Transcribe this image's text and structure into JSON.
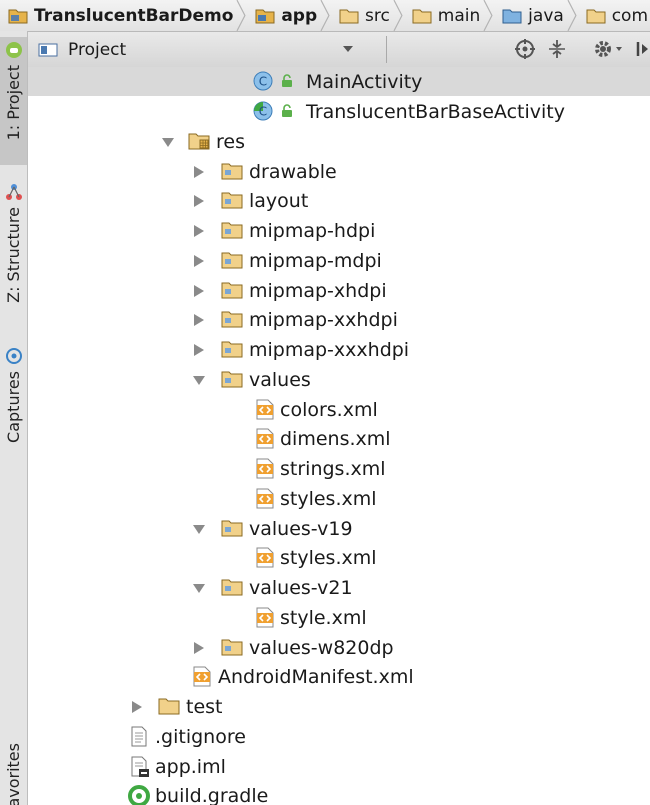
{
  "breadcrumb": [
    {
      "label": "TranslucentBarDemo",
      "icon": "project-folder-icon",
      "bold": true
    },
    {
      "label": "app",
      "icon": "module-folder-icon",
      "bold": true
    },
    {
      "label": "src",
      "icon": "folder-icon",
      "bold": false
    },
    {
      "label": "main",
      "icon": "folder-icon",
      "bold": false
    },
    {
      "label": "java",
      "icon": "source-folder-icon",
      "bold": false
    },
    {
      "label": "com",
      "icon": "folder-icon",
      "bold": false
    }
  ],
  "sidebar": {
    "project_label": "1: Project",
    "structure_label": "Z: Structure",
    "captures_label": "Captures",
    "favorites_label": "Favorites"
  },
  "panel": {
    "view_label": "Project",
    "icons": [
      "locate-icon",
      "collapse-icon",
      "gear-icon",
      "hide-icon"
    ]
  },
  "tree": [
    {
      "label": "MainActivity",
      "type": "class",
      "selected": true
    },
    {
      "label": "TranslucentBarBaseActivity",
      "type": "class-base",
      "selected": false
    },
    {
      "label": "res",
      "type": "res-folder",
      "expanded": true
    },
    {
      "label": "drawable",
      "type": "folder",
      "expanded": false
    },
    {
      "label": "layout",
      "type": "folder",
      "expanded": false
    },
    {
      "label": "mipmap-hdpi",
      "type": "folder",
      "expanded": false
    },
    {
      "label": "mipmap-mdpi",
      "type": "folder",
      "expanded": false
    },
    {
      "label": "mipmap-xhdpi",
      "type": "folder",
      "expanded": false
    },
    {
      "label": "mipmap-xxhdpi",
      "type": "folder",
      "expanded": false
    },
    {
      "label": "mipmap-xxxhdpi",
      "type": "folder",
      "expanded": false
    },
    {
      "label": "values",
      "type": "folder",
      "expanded": true
    },
    {
      "label": "colors.xml",
      "type": "xml"
    },
    {
      "label": "dimens.xml",
      "type": "xml"
    },
    {
      "label": "strings.xml",
      "type": "xml"
    },
    {
      "label": "styles.xml",
      "type": "xml"
    },
    {
      "label": "values-v19",
      "type": "folder",
      "expanded": true
    },
    {
      "label": "styles.xml",
      "type": "xml"
    },
    {
      "label": "values-v21",
      "type": "folder",
      "expanded": true
    },
    {
      "label": "style.xml",
      "type": "xml"
    },
    {
      "label": "values-w820dp",
      "type": "folder",
      "expanded": false
    },
    {
      "label": "AndroidManifest.xml",
      "type": "manifest"
    },
    {
      "label": "test",
      "type": "plain-folder",
      "expanded": false
    },
    {
      "label": ".gitignore",
      "type": "text"
    },
    {
      "label": "app.iml",
      "type": "iml"
    },
    {
      "label": "build.gradle",
      "type": "gradle"
    }
  ],
  "colors": {
    "folder_fill": "#e6b34a",
    "class_blue": "#5fa8e0",
    "xml_orange": "#f0a030",
    "gradle_green": "#3fa842",
    "selected_row": "#d9d9d9"
  }
}
